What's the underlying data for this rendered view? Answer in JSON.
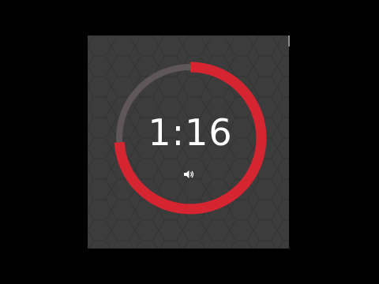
{
  "timer": {
    "display": "1:16",
    "progress_fraction": 0.74,
    "sound_icon": "speaker-icon"
  },
  "colors": {
    "background": "#000000",
    "panel": "#3c3c3c",
    "progress": "#d42530",
    "track": "#5e5658",
    "text": "#ffffff"
  }
}
